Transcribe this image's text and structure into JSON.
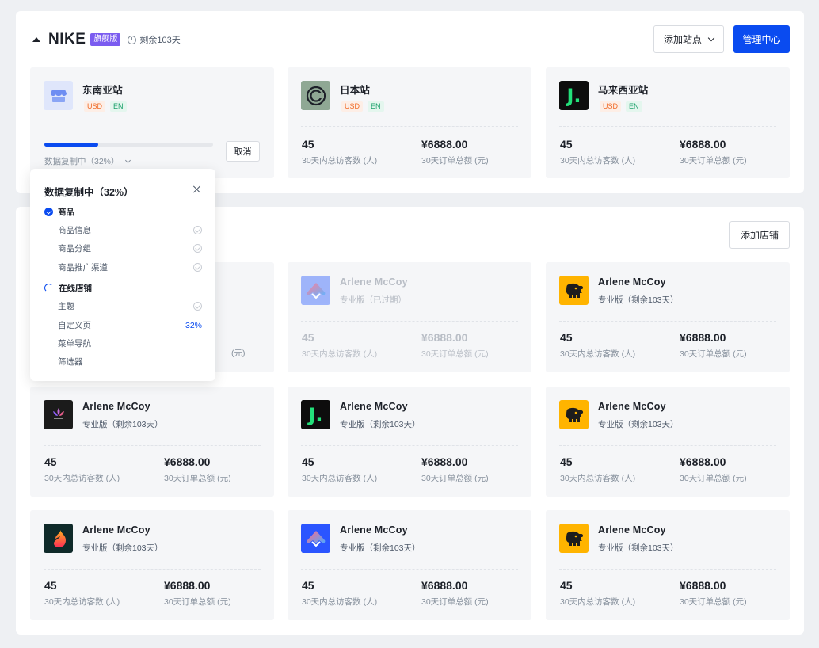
{
  "header": {
    "brand": "NIKE",
    "badge": "旗舰版",
    "remaining": "剩余103天",
    "add_site_label": "添加站点",
    "manage_label": "管理中心"
  },
  "sites": [
    {
      "name": "东南亚站",
      "currency": "USD",
      "lang": "EN",
      "logo": "shop-icon"
    },
    {
      "name": "日本站",
      "currency": "USD",
      "lang": "EN",
      "logo": "circle-c-logo",
      "visitors": "45",
      "visitors_label": "30天内总访客数 (人)",
      "orders": "¥6888.00",
      "orders_label": "30天订单总额 (元)"
    },
    {
      "name": "马来西亚站",
      "currency": "USD",
      "lang": "EN",
      "logo": "j-logo",
      "visitors": "45",
      "visitors_label": "30天内总访客数 (人)",
      "orders": "¥6888.00",
      "orders_label": "30天订单总额 (元)"
    }
  ],
  "copy_progress": {
    "label": "数据复制中（32%）",
    "percent": 32,
    "cancel_label": "取消"
  },
  "popover": {
    "title": "数据复制中（32%）",
    "groups": [
      {
        "label": "商品",
        "status": "done",
        "items": [
          {
            "label": "商品信息",
            "status": "done"
          },
          {
            "label": "商品分组",
            "status": "done"
          },
          {
            "label": "商品推广渠道",
            "status": "done"
          }
        ]
      },
      {
        "label": "在线店铺",
        "status": "loading",
        "items": [
          {
            "label": "主题",
            "status": "done"
          },
          {
            "label": "自定义页",
            "status": "progress",
            "value": "32%"
          },
          {
            "label": "菜单导航",
            "status": "pending"
          },
          {
            "label": "筛选器",
            "status": "pending"
          }
        ]
      }
    ]
  },
  "add_store_label": "添加店铺",
  "stores": [
    {
      "name": "",
      "plan": "",
      "logo": "hidden",
      "visitors": "",
      "visitors_label": "",
      "orders": "",
      "orders_label": "(元)"
    },
    {
      "name": "Arlene McCoy",
      "plan": "专业版（已过期）",
      "logo": "house-logo",
      "expired": true,
      "visitors": "45",
      "visitors_label": "30天内总访客数 (人)",
      "orders": "¥6888.00",
      "orders_label": "30天订单总额 (元)"
    },
    {
      "name": "Arlene McCoy",
      "plan": "专业版（剩余103天）",
      "logo": "elephant-logo",
      "visitors": "45",
      "visitors_label": "30天内总访客数 (人)",
      "orders": "¥6888.00",
      "orders_label": "30天订单总额 (元)"
    },
    {
      "name": "Arlene McCoy",
      "plan": "专业版（剩余103天）",
      "logo": "lotus-logo",
      "visitors": "45",
      "visitors_label": "30天内总访客数 (人)",
      "orders": "¥6888.00",
      "orders_label": "30天订单总额 (元)"
    },
    {
      "name": "Arlene McCoy",
      "plan": "专业版（剩余103天）",
      "logo": "j-logo",
      "visitors": "45",
      "visitors_label": "30天内总访客数 (人)",
      "orders": "¥6888.00",
      "orders_label": "30天订单总额 (元)"
    },
    {
      "name": "Arlene McCoy",
      "plan": "专业版（剩余103天）",
      "logo": "elephant-logo",
      "visitors": "45",
      "visitors_label": "30天内总访客数 (人)",
      "orders": "¥6888.00",
      "orders_label": "30天订单总额 (元)"
    },
    {
      "name": "Arlene McCoy",
      "plan": "专业版（剩余103天）",
      "logo": "flame-logo",
      "visitors": "45",
      "visitors_label": "30天内总访客数 (人)",
      "orders": "¥6888.00",
      "orders_label": "30天订单总额 (元)"
    },
    {
      "name": "Arlene McCoy",
      "plan": "专业版（剩余103天）",
      "logo": "house-logo",
      "visitors": "45",
      "visitors_label": "30天内总访客数 (人)",
      "orders": "¥6888.00",
      "orders_label": "30天订单总额 (元)"
    },
    {
      "name": "Arlene McCoy",
      "plan": "专业版（剩余103天）",
      "logo": "elephant-logo",
      "visitors": "45",
      "visitors_label": "30天内总访客数 (人)",
      "orders": "¥6888.00",
      "orders_label": "30天订单总额 (元)"
    }
  ]
}
